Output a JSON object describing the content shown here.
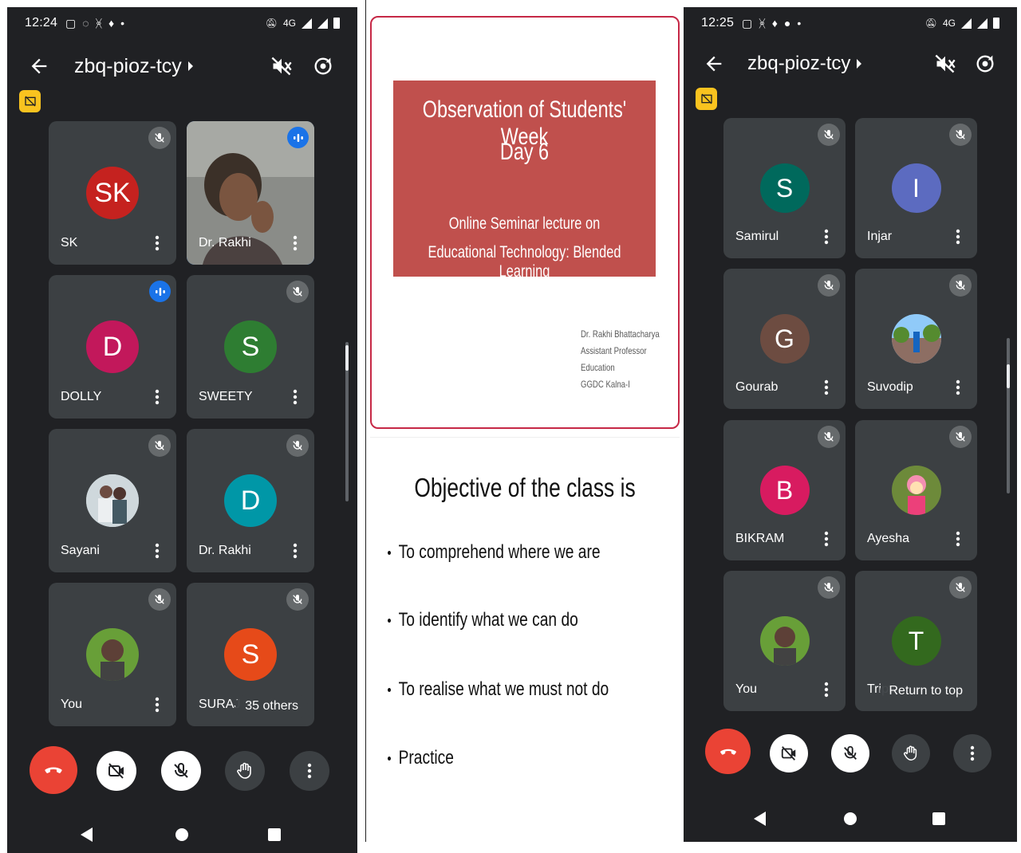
{
  "left_phone": {
    "status": {
      "time": "12:24",
      "network": "4G"
    },
    "meeting_code": "zbq-pioz-tcy",
    "tiles": [
      {
        "name": "SK",
        "initials": "SK",
        "color": "#c5221f",
        "mic": "muted"
      },
      {
        "name": "Dr. Rakhi",
        "initials": "",
        "color": "#5f6368",
        "mic": "speaking",
        "video": true
      },
      {
        "name": "DOLLY",
        "initials": "D",
        "color": "#c2185b",
        "mic": "speaking"
      },
      {
        "name": "SWEETY",
        "initials": "S",
        "color": "#2e7d32",
        "mic": "muted"
      },
      {
        "name": "Sayani",
        "initials": "",
        "color": "#90a4ae",
        "mic": "muted",
        "photo": true
      },
      {
        "name": "Dr. Rakhi",
        "initials": "D",
        "color": "#0097a7",
        "mic": "muted"
      },
      {
        "name": "You",
        "initials": "",
        "color": "#558b2f",
        "mic": "muted",
        "photo": true
      },
      {
        "name": "SURAJ",
        "initials": "S",
        "color": "#e64a19",
        "mic": "muted"
      }
    ],
    "others_chip": "35 others"
  },
  "slides": {
    "title_line1": "Observation of Students' Week",
    "title_line2": "Day 6",
    "subtitle_line1": "Online Seminar lecture on",
    "subtitle_line2": "Educational Technology: Blended Learning",
    "author": [
      "Dr. Rakhi Bhattacharya",
      "Assistant Professor",
      "Education",
      "GGDC Kalna-I"
    ],
    "objective_title": "Objective of the class is",
    "bullets": [
      "To comprehend where we are",
      "To identify what we can do",
      "To realise what we must not do",
      "Practice"
    ]
  },
  "right_phone": {
    "status": {
      "time": "12:25",
      "network": "4G"
    },
    "meeting_code": "zbq-pioz-tcy",
    "tiles": [
      {
        "name": "Samirul",
        "initials": "S",
        "color": "#00695c",
        "mic": "muted"
      },
      {
        "name": "Injar",
        "initials": "I",
        "color": "#5c6bc0",
        "mic": "muted"
      },
      {
        "name": "Gourab",
        "initials": "G",
        "color": "#6d4c41",
        "mic": "muted"
      },
      {
        "name": "Suvodip",
        "initials": "",
        "color": "#7cb342",
        "mic": "muted",
        "photo": true
      },
      {
        "name": "BIKRAM",
        "initials": "B",
        "color": "#d81b60",
        "mic": "muted"
      },
      {
        "name": "Ayesha",
        "initials": "",
        "color": "#6d8a3a",
        "mic": "muted",
        "photo": true
      },
      {
        "name": "You",
        "initials": "",
        "color": "#558b2f",
        "mic": "muted",
        "photo": true
      },
      {
        "name": "Tripti",
        "initials": "T",
        "color": "#33691e",
        "mic": "muted"
      }
    ],
    "return_chip": "Return to top"
  },
  "colors": {
    "background": "#202124",
    "tile": "#3c4043",
    "end_call": "#ea4335",
    "speaking": "#1a73e8",
    "badge": "#f9c31f"
  }
}
